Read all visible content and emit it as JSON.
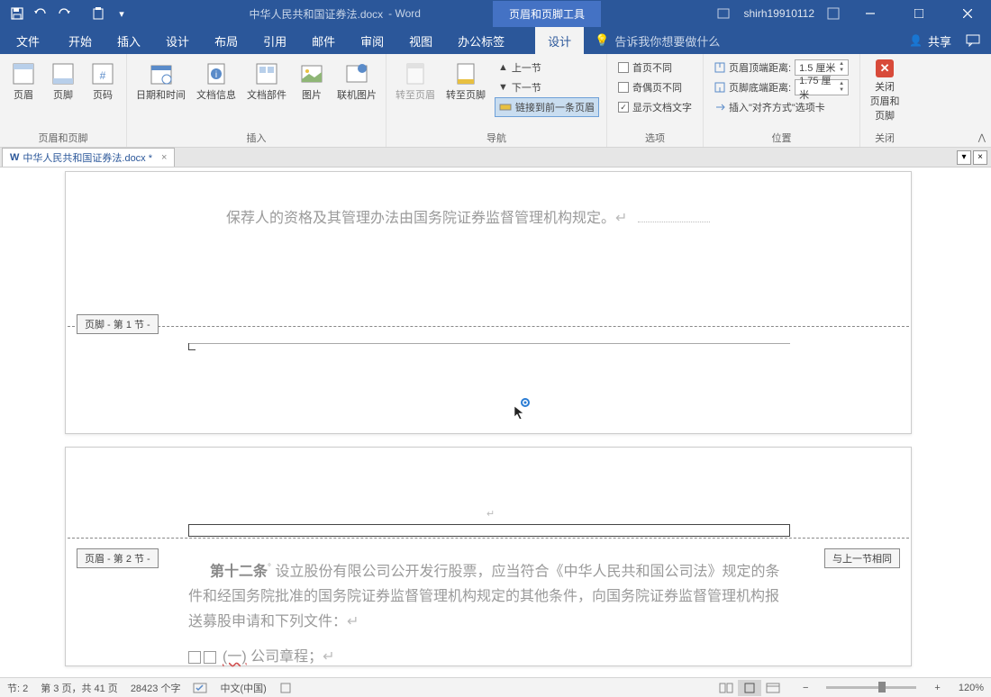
{
  "titlebar": {
    "doc_title": "中华人民共和国证券法.docx",
    "app_suffix": "  -  Word",
    "context_tab": "页眉和页脚工具",
    "username": "shirh19910112"
  },
  "tabs": {
    "file": "文件",
    "home": "开始",
    "insert": "插入",
    "design": "设计",
    "layout": "布局",
    "references": "引用",
    "mailings": "邮件",
    "review": "审阅",
    "view": "视图",
    "office_tab": "办公标签",
    "hf_design": "设计",
    "tellme_placeholder": "告诉我你想要做什么",
    "share": "共享"
  },
  "ribbon": {
    "group_hf": "页眉和页脚",
    "header": "页眉",
    "footer": "页脚",
    "page_number": "页码",
    "group_insert": "插入",
    "date_time": "日期和时间",
    "doc_info": "文档信息",
    "doc_parts": "文档部件",
    "picture": "图片",
    "online_picture": "联机图片",
    "group_nav": "导航",
    "goto_header": "转至页眉",
    "goto_footer": "转至页脚",
    "prev_section": "上一节",
    "next_section": "下一节",
    "link_previous": "链接到前一条页眉",
    "group_options": "选项",
    "diff_first": "首页不同",
    "diff_odd_even": "奇偶页不同",
    "show_doc_text": "显示文档文字",
    "group_position": "位置",
    "header_top": "页眉顶端距离:",
    "footer_bottom": "页脚底端距离:",
    "val_15": "1.5 厘米",
    "val_175": "1.75 厘米",
    "insert_align_tab": "插入\"对齐方式\"选项卡",
    "group_close": "关闭",
    "close_hf": "关闭\n页眉和页脚"
  },
  "doctab": {
    "name": "中华人民共和国证券法.docx *"
  },
  "content": {
    "para1": "保荐人的资格及其管理办法由国务院证券监督管理机构规定。",
    "footer_section1": "页脚 - 第 1 节 -",
    "header_section2": "页眉 - 第 2 节 -",
    "same_as_prev": "与上一节相同",
    "article12_bold": "第十二条",
    "para2_rest": "  设立股份有限公司公开发行股票，应当符合《中华人民共和国公司法》规定的条件和经国务院批准的国务院证券监督管理机构规定的其他条件，向国务院证券监督管理机构报送募股申请和下列文件：",
    "list_item1_num": "(一)",
    "list_item1_text": " 公司章程；"
  },
  "statusbar": {
    "section": "节: 2",
    "page": "第 3 页，共 41 页",
    "words": "28423 个字",
    "proofing": "",
    "language": "中文(中国)",
    "zoom": "120%"
  }
}
